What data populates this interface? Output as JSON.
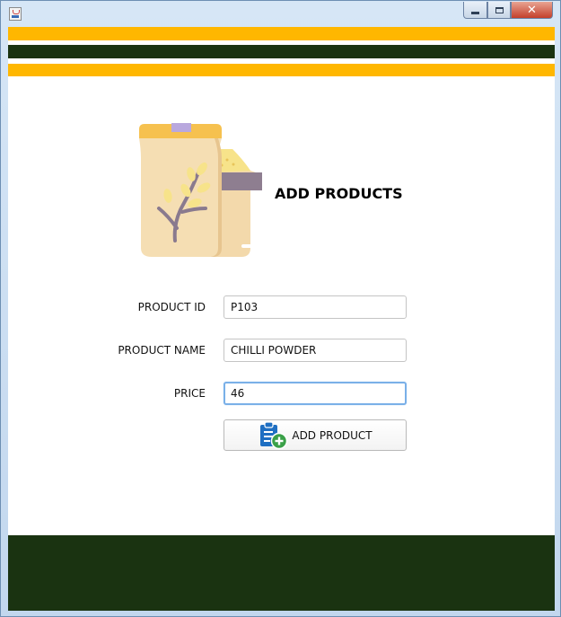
{
  "window": {
    "controls": {
      "minimize": "minimize",
      "maximize": "maximize",
      "close": "✕"
    }
  },
  "colors": {
    "accent_yellow": "#ffb700",
    "dark_green": "#1a3311",
    "focus_blue": "#7ab0e8"
  },
  "header": {
    "title": "ADD PRODUCTS"
  },
  "form": {
    "product_id": {
      "label": "PRODUCT ID",
      "value": "P103"
    },
    "product_name": {
      "label": "PRODUCT NAME",
      "value": "CHILLI POWDER"
    },
    "price": {
      "label": "PRICE",
      "value": "46"
    },
    "submit_label": "ADD PRODUCT"
  },
  "icons": [
    "java-app-icon",
    "grain-bags-icon",
    "clipboard-add-icon"
  ]
}
